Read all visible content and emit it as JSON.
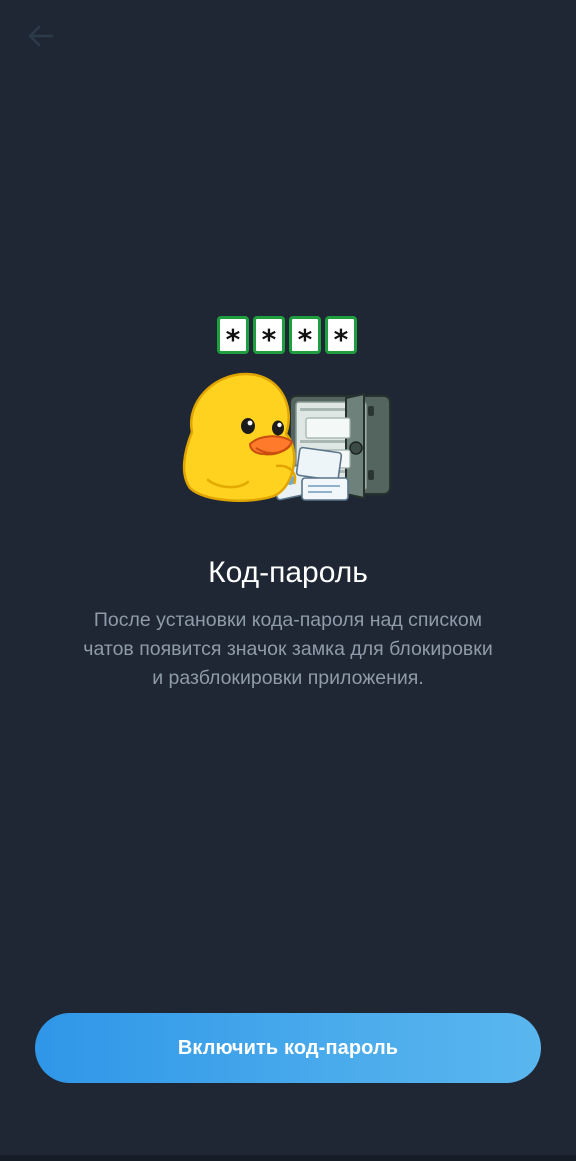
{
  "header": {
    "back_icon": "arrow-left-icon"
  },
  "sticker": {
    "description_icon": "duck-with-safe-sticker",
    "pin_chars": [
      "*",
      "*",
      "*",
      "*"
    ]
  },
  "content": {
    "title": "Код-пароль",
    "description": "После установки кода-пароля над списком чатов появится значок замка для блокировки и разблокировки приложения."
  },
  "action": {
    "button_label": "Включить код-пароль"
  },
  "colors": {
    "background": "#1e2733",
    "accent": "#3a9fe9",
    "secondary_text": "#8f9ba8",
    "pin_border": "#1f9e3f"
  }
}
